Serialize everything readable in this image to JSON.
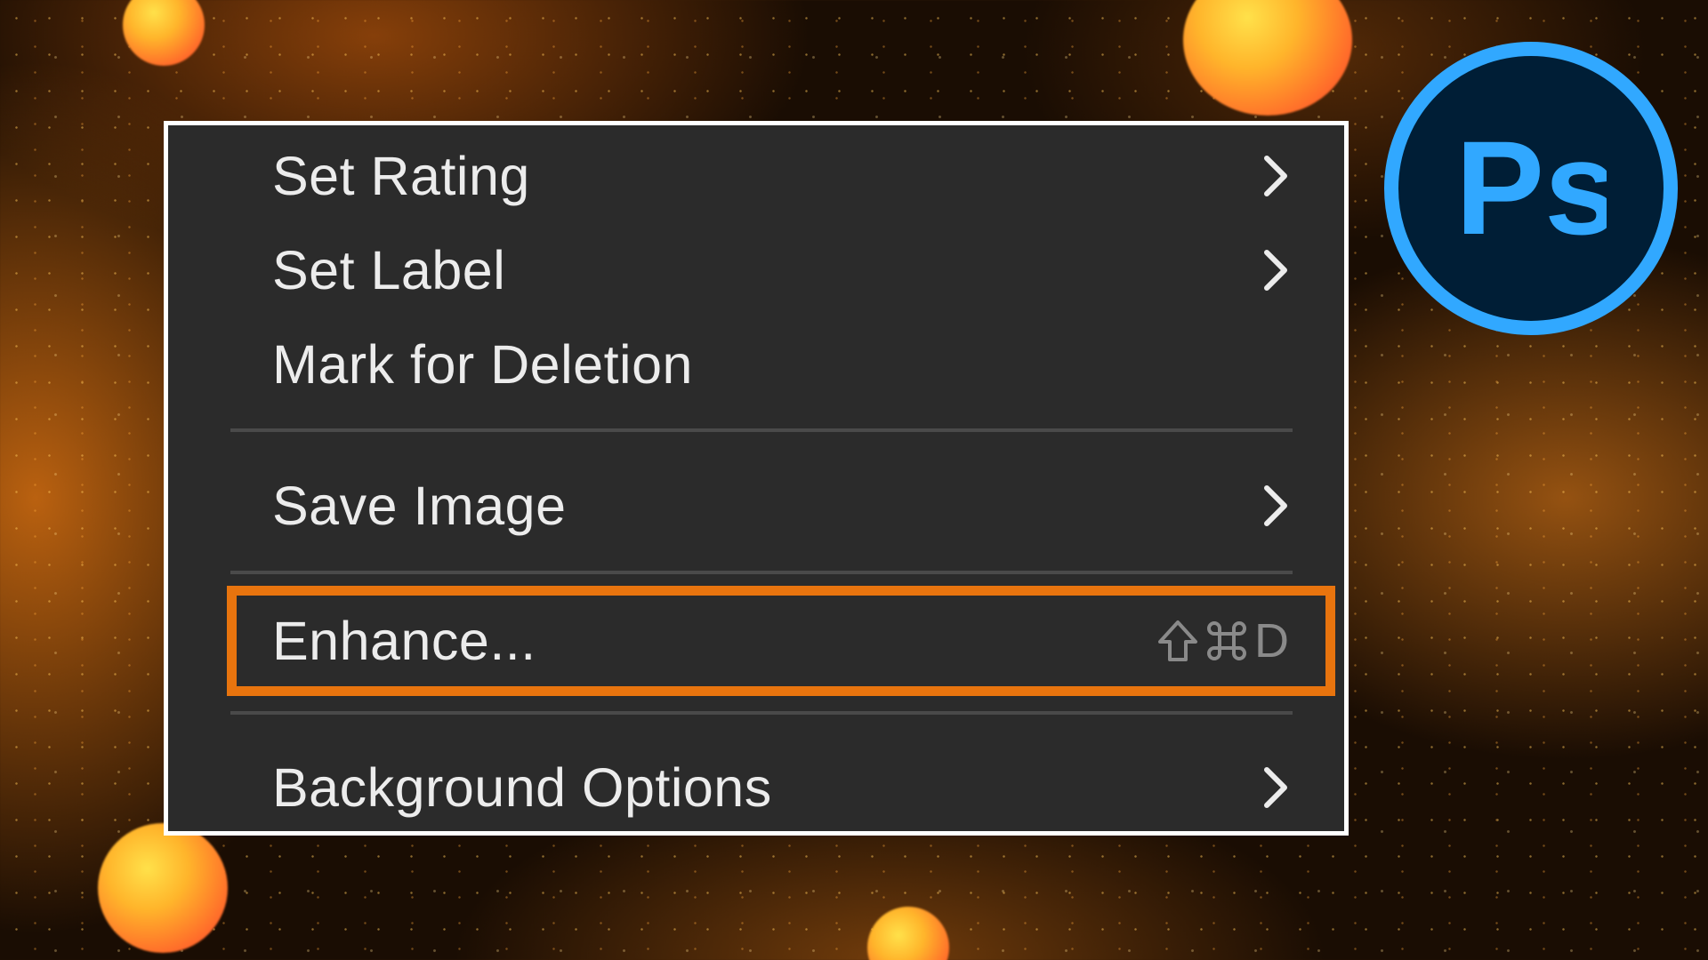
{
  "menu": {
    "items": [
      {
        "label": "Set Rating",
        "has_submenu": true
      },
      {
        "label": "Set Label",
        "has_submenu": true
      },
      {
        "label": "Mark for Deletion",
        "has_submenu": false
      },
      {
        "label": "Save Image",
        "has_submenu": true
      },
      {
        "label": "Enhance...",
        "has_submenu": false,
        "shortcut": "⇧⌘D",
        "highlighted": true
      },
      {
        "label": "Background Options",
        "has_submenu": true
      }
    ],
    "highlight_color": "#e8740e"
  },
  "logo": {
    "text": "Ps",
    "ring_color": "#31a8ff",
    "fill_color": "#001e36"
  },
  "icons": {
    "submenu": "chevron-right-icon",
    "shortcut_shift": "shift-icon",
    "shortcut_command": "command-icon"
  }
}
